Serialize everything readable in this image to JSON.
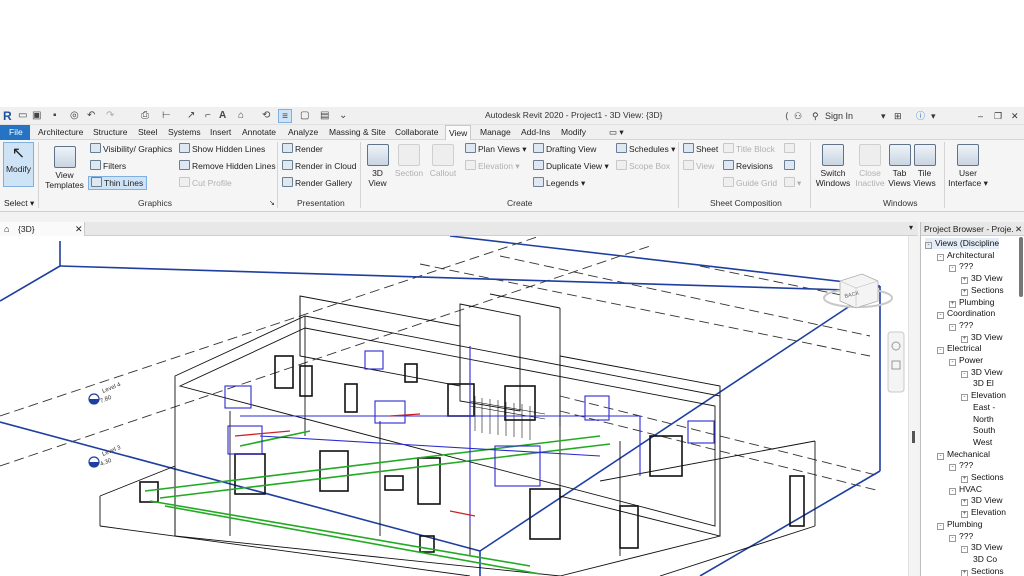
{
  "app": {
    "title": "Autodesk Revit 2020 - Project1 - 3D View: {3D}",
    "sign_in": "Sign In"
  },
  "tabs": [
    "File",
    "Architecture",
    "Structure",
    "Steel",
    "Systems",
    "Insert",
    "Annotate",
    "Analyze",
    "Massing & Site",
    "Collaborate",
    "View",
    "Manage",
    "Add-Ins",
    "Modify"
  ],
  "active_tab": "View",
  "ribbon": {
    "select": {
      "modify": "Modify",
      "select": "Select"
    },
    "graphics": {
      "view_templates_1": "View",
      "view_templates_2": "Templates",
      "visibility": "Visibility/ Graphics",
      "filters": "Filters",
      "thin_lines": "Thin Lines",
      "show_hidden": "Show Hidden Lines",
      "remove_hidden": "Remove Hidden Lines",
      "cut_profile": "Cut Profile",
      "label": "Graphics"
    },
    "presentation": {
      "render": "Render",
      "render_cloud": "Render in Cloud",
      "render_gallery": "Render Gallery",
      "label": "Presentation"
    },
    "create": {
      "view3d_1": "3D",
      "view3d_2": "View",
      "section": "Section",
      "callout": "Callout",
      "plan_views": "Plan Views",
      "elevation": "Elevation",
      "drafting_view": "Drafting View",
      "duplicate_view": "Duplicate View",
      "legends": "Legends",
      "schedules": "Schedules",
      "scope_box": "Scope Box",
      "label": "Create"
    },
    "sheet_composition": {
      "sheet": "Sheet",
      "view": "View",
      "title_block": "Title Block",
      "revisions": "Revisions",
      "guide_grid": "Guide Grid",
      "label": "Sheet Composition"
    },
    "windows": {
      "switch_1": "Switch",
      "switch_2": "Windows",
      "close_1": "Close",
      "close_2": "Inactive",
      "tab_1": "Tab",
      "tab_2": "Views",
      "tile_1": "Tile",
      "tile_2": "Views",
      "ui_1": "User",
      "ui_2": "Interface",
      "label": "Windows"
    }
  },
  "view_tab": {
    "label": "{3D}"
  },
  "viewport": {
    "level4_name": "Level 4",
    "level4_elev": "7.80",
    "level3_name": "Level 3",
    "level3_elev": "4.30",
    "viewcube_face": "BACK"
  },
  "project_browser": {
    "title": "Project Browser - Proje...",
    "nodes": [
      {
        "label": "Views (Discipline",
        "depth": 0,
        "exp": "-"
      },
      {
        "label": "Architectural",
        "depth": 1,
        "exp": "-"
      },
      {
        "label": "???",
        "depth": 2,
        "exp": "-"
      },
      {
        "label": "3D View",
        "depth": 3,
        "exp": "+"
      },
      {
        "label": "Sections",
        "depth": 3,
        "exp": "+"
      },
      {
        "label": "Plumbing",
        "depth": 2,
        "exp": "+"
      },
      {
        "label": "Coordination",
        "depth": 1,
        "exp": "-"
      },
      {
        "label": "???",
        "depth": 2,
        "exp": "-"
      },
      {
        "label": "3D View",
        "depth": 3,
        "exp": "+"
      },
      {
        "label": "Electrical",
        "depth": 1,
        "exp": "-"
      },
      {
        "label": "Power",
        "depth": 2,
        "exp": "-"
      },
      {
        "label": "3D View",
        "depth": 3,
        "exp": "-"
      },
      {
        "label": "3D El",
        "depth": 4,
        "exp": ""
      },
      {
        "label": "Elevation",
        "depth": 3,
        "exp": "-"
      },
      {
        "label": "East -",
        "depth": 4,
        "exp": ""
      },
      {
        "label": "North",
        "depth": 4,
        "exp": ""
      },
      {
        "label": "South",
        "depth": 4,
        "exp": ""
      },
      {
        "label": "West",
        "depth": 4,
        "exp": ""
      },
      {
        "label": "Mechanical",
        "depth": 1,
        "exp": "-"
      },
      {
        "label": "???",
        "depth": 2,
        "exp": "-"
      },
      {
        "label": "Sections",
        "depth": 3,
        "exp": "+"
      },
      {
        "label": "HVAC",
        "depth": 2,
        "exp": "-"
      },
      {
        "label": "3D View",
        "depth": 3,
        "exp": "+"
      },
      {
        "label": "Elevation",
        "depth": 3,
        "exp": "+"
      },
      {
        "label": "Plumbing",
        "depth": 1,
        "exp": "-"
      },
      {
        "label": "???",
        "depth": 2,
        "exp": "-"
      },
      {
        "label": "3D View",
        "depth": 3,
        "exp": "-"
      },
      {
        "label": "3D Co",
        "depth": 4,
        "exp": ""
      },
      {
        "label": "Sections",
        "depth": 3,
        "exp": "+"
      }
    ]
  },
  "colors": {
    "file_tab": "#2574c4",
    "selection": "#cfe3f7",
    "section_box": "#1f3fa0",
    "plumbing_green": "#22aa22",
    "duct_blue": "#2a2ad0",
    "pipe_red": "#cc2222"
  }
}
